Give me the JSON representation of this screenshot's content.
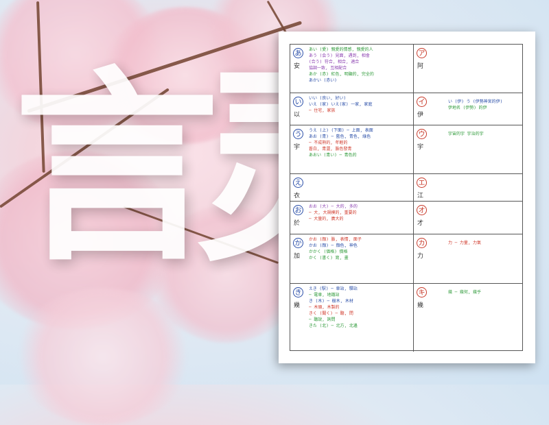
{
  "background": {
    "big_glyphs": [
      "言",
      "灵"
    ],
    "colors": {
      "blossom_pink": "#f6c9d5",
      "sky_blue": "#cfe2f2",
      "branch_brown": "#7a4b3a"
    }
  },
  "note_sheet": {
    "rows": [
      {
        "hira": "あ",
        "hira_kanji": "安",
        "hira_notes": [
          {
            "text": "あい (愛) 親愛的情感, 親愛的人",
            "c": "g"
          },
          {
            "text": "あう (会う) 見面, 遇到, 相會",
            "c": "p"
          },
          {
            "text": "   (合う) 符合, 相合, 適合",
            "c": "p"
          },
          {
            "text": "   協調一致, 互相配合",
            "c": "p"
          },
          {
            "text": "あか (赤) 紅色, 明顯的, 完全的",
            "c": "g"
          },
          {
            "text": "あかい (赤い)",
            "c": "b"
          }
        ],
        "kata": "ア",
        "kata_kanji": "阿",
        "kata_notes": []
      },
      {
        "hira": "い",
        "hira_kanji": "以",
        "hira_notes": [
          {
            "text": "いい (良い, 好い)",
            "c": "b"
          },
          {
            "text": "いえ (家) いえ(家) 一家, 家庭",
            "c": "b"
          },
          {
            "text": "   ─ 住宅, 家族",
            "c": "r"
          }
        ],
        "kata": "イ",
        "kata_kanji": "伊",
        "kata_notes": [
          {
            "text": "い (伊) う (伊勢神宮的伊)",
            "c": "b"
          },
          {
            "text": "伊地名 (伊勢) 的伊",
            "c": "g"
          }
        ]
      },
      {
        "hira": "う",
        "hira_kanji": "宇",
        "hira_notes": [
          {
            "text": "うえ (上) (下面) ─ 上面, 表面",
            "c": "b"
          },
          {
            "text": "あお (青) ─ 藍色, 青色, 綠色",
            "c": "b"
          },
          {
            "text": "   ─ 不成熟的, 年輕的",
            "c": "r"
          },
          {
            "text": "   蒼白, 青澀, 臉色發青",
            "c": "r"
          },
          {
            "text": "あおい (青い) ─ 青色的",
            "c": "g"
          }
        ],
        "kata": "ウ",
        "kata_kanji": "宇",
        "kata_notes": [
          {
            "text": "宇宙的宇 宇治的宇",
            "c": "g"
          }
        ]
      },
      {
        "hira": "え",
        "hira_kanji": "衣",
        "hira_notes": [],
        "kata": "エ",
        "kata_kanji": "江",
        "kata_notes": []
      },
      {
        "hira": "お",
        "hira_kanji": "於",
        "hira_notes": [
          {
            "text": "おお (大) ─ 大的, 多的",
            "c": "p"
          },
          {
            "text": "   ─ 大, 大規模的, 重要的",
            "c": "r"
          },
          {
            "text": "   ─ 大量的, 廣大的",
            "c": "r"
          }
        ],
        "kata": "オ",
        "kata_kanji": "才",
        "kata_notes": []
      },
      {
        "hira": "か",
        "hira_kanji": "加",
        "hira_notes": [
          {
            "text": "かお (顔) 臉, 表情, 面子",
            "c": "r"
          },
          {
            "text": "かお (顔) ─ 顔色, 神色",
            "c": "b"
          },
          {
            "text": "かかく (価格) 價格",
            "c": "g"
          },
          {
            "text": "かく (書く) 寫, 畫",
            "c": "g"
          }
        ],
        "kata": "カ",
        "kata_kanji": "力",
        "kata_notes": [
          {
            "text": "力 ─ 力量, 力氣",
            "c": "r"
          }
        ]
      },
      {
        "hira": "き",
        "hira_kanji": "幾",
        "hira_notes": [
          {
            "text": "えき (駅) ─ 車站, 驛站",
            "c": "b"
          },
          {
            "text": "   ─ 電車, 地鐵站",
            "c": "g"
          },
          {
            "text": "き (木) ─ 樹木, 木材",
            "c": "b"
          },
          {
            "text": "   ─ 木頭, 木製的",
            "c": "r"
          },
          {
            "text": "きく (聞く) ─ 聽, 問",
            "c": "r"
          },
          {
            "text": "   ─ 聽說, 詢問",
            "c": "g"
          },
          {
            "text": "きた (北) ─ 北方, 北邊",
            "c": "g"
          }
        ],
        "kata": "キ",
        "kata_kanji": "幾",
        "kata_notes": [
          {
            "text": "幾 ─ 幾何, 幾乎",
            "c": "g"
          }
        ]
      }
    ]
  }
}
